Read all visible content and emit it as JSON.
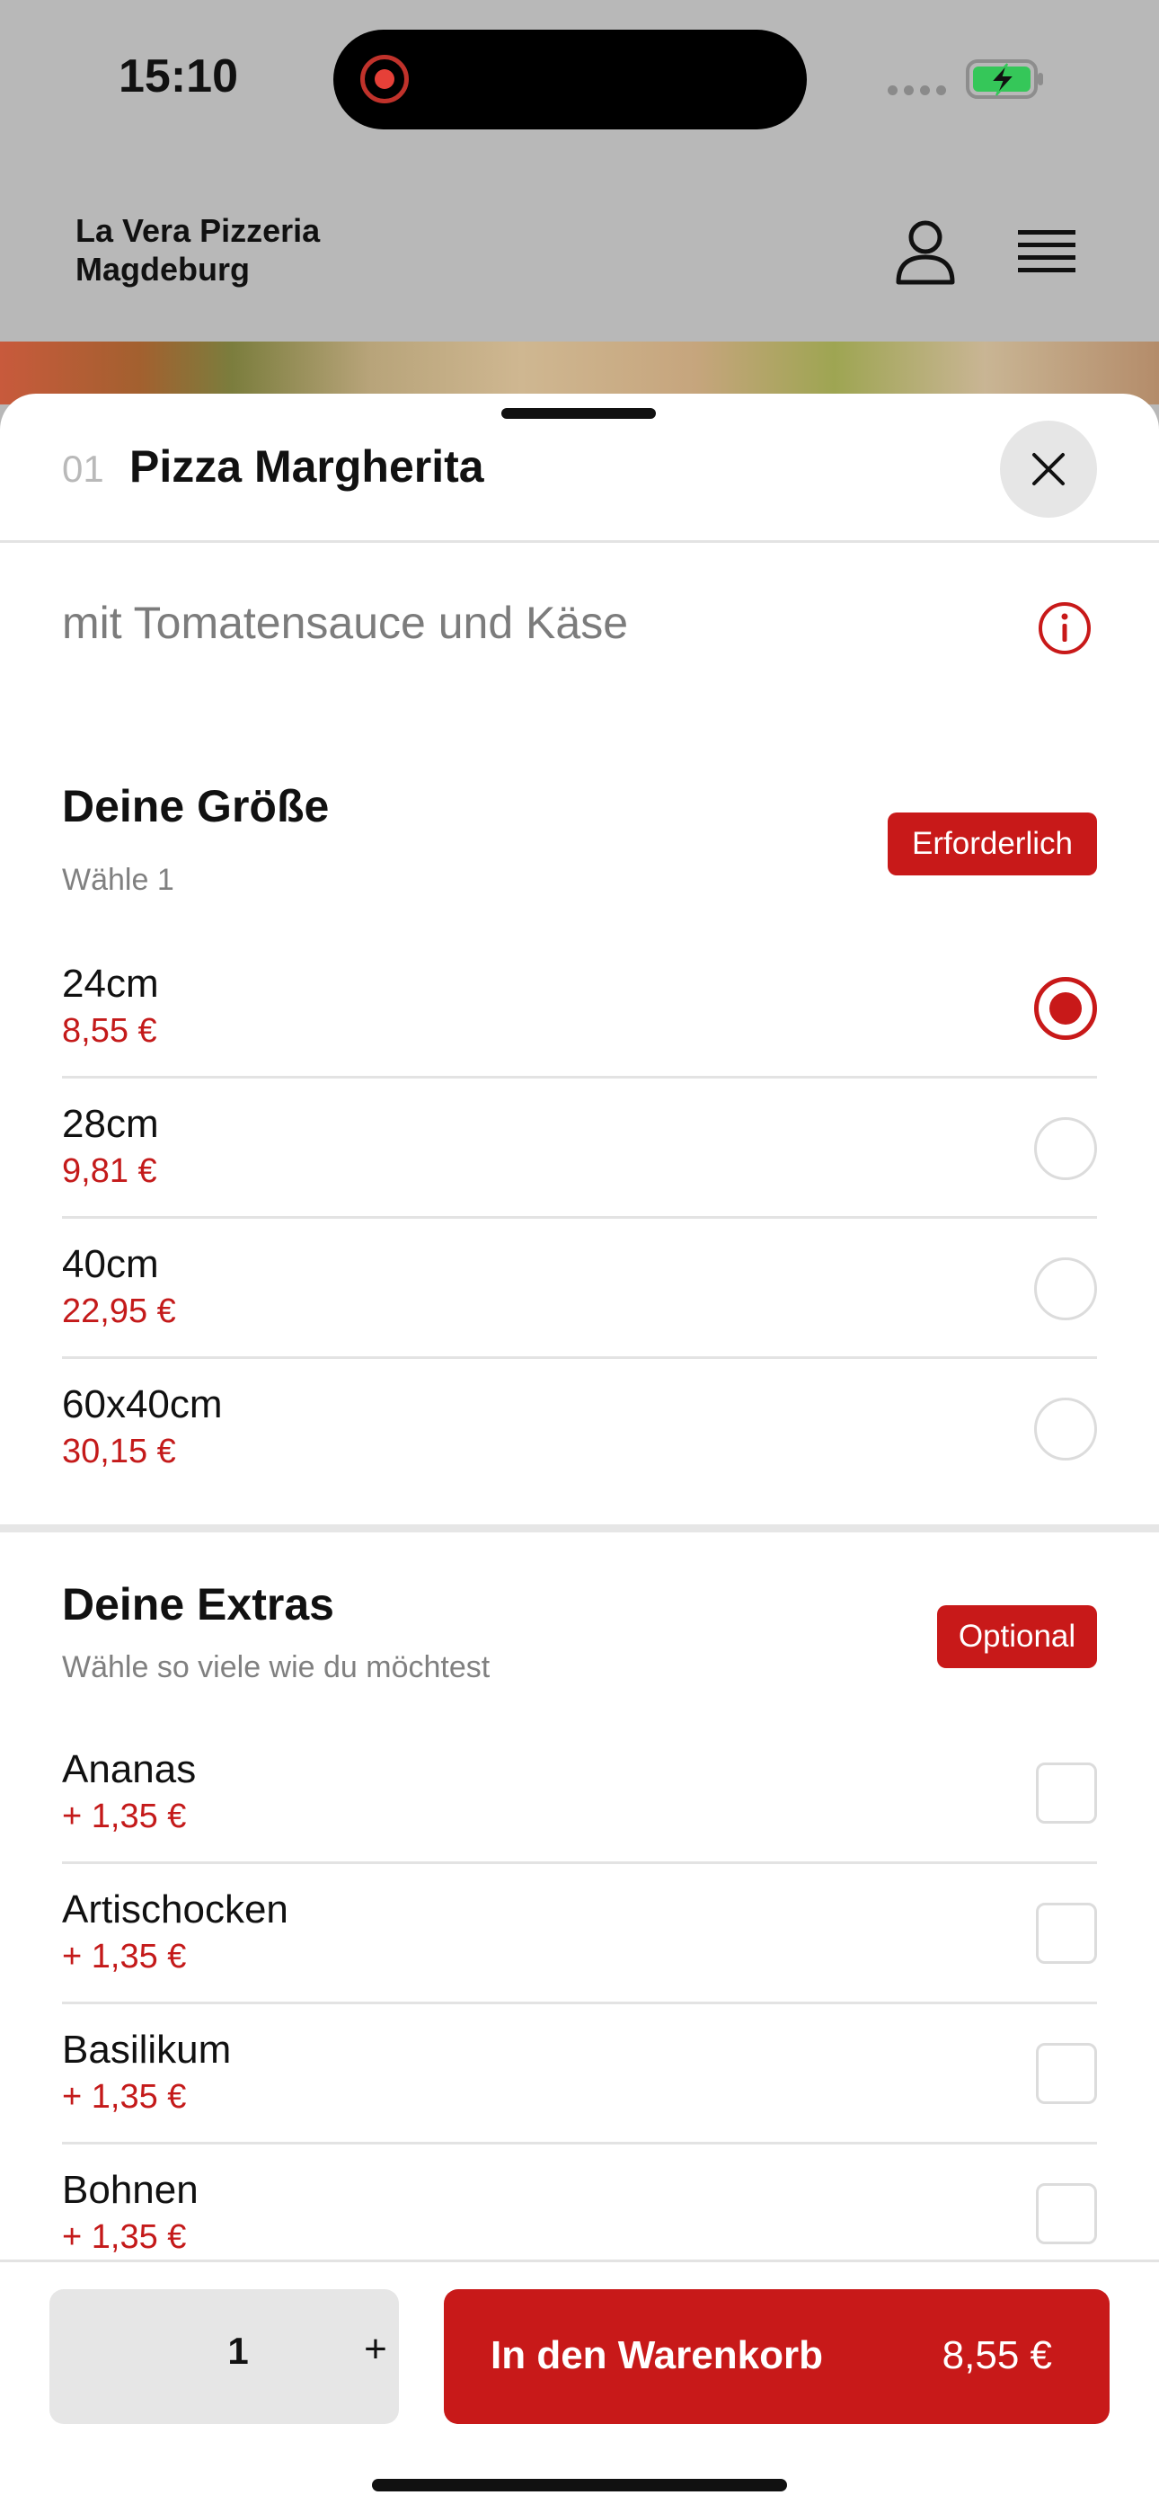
{
  "status_bar": {
    "time": "15:10"
  },
  "header": {
    "brand_line1": "La Vera Pizzeria",
    "brand_line2": "Magdeburg"
  },
  "item": {
    "number": "01",
    "title": "Pizza Margherita",
    "description": "mit Tomatensauce und Käse"
  },
  "size_section": {
    "title": "Deine Größe",
    "subtitle": "Wähle 1",
    "badge": "Erforderlich",
    "options": [
      {
        "name": "24cm",
        "price": "8,55 €",
        "selected": true
      },
      {
        "name": "28cm",
        "price": "9,81 €",
        "selected": false
      },
      {
        "name": "40cm",
        "price": "22,95 €",
        "selected": false
      },
      {
        "name": "60x40cm",
        "price": "30,15 €",
        "selected": false
      }
    ]
  },
  "extras_section": {
    "title": "Deine Extras",
    "subtitle": "Wähle so viele wie du möchtest",
    "badge": "Optional",
    "options": [
      {
        "name": "Ananas",
        "price": "+ 1,35 €",
        "checked": false
      },
      {
        "name": "Artischocken",
        "price": "+ 1,35 €",
        "checked": false
      },
      {
        "name": "Basilikum",
        "price": "+ 1,35 €",
        "checked": false
      },
      {
        "name": "Bohnen",
        "price": "+ 1,35 €",
        "checked": false
      }
    ]
  },
  "footer": {
    "quantity": "1",
    "plus_label": "+",
    "cart_label": "In den Warenkorb",
    "cart_price": "8,55 €"
  },
  "colors": {
    "accent": "#c81919",
    "backdrop": "#b8b8b8",
    "divider": "#e3e3e3"
  },
  "icons": {
    "user": "user-icon",
    "menu": "menu-icon",
    "close": "close-icon",
    "info": "info-icon"
  }
}
